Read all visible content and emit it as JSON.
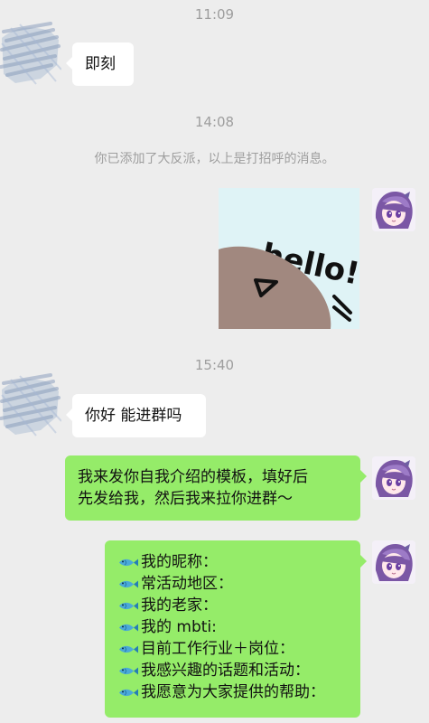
{
  "chat": {
    "timestamps": [
      "11:09",
      "14:08",
      "15:40"
    ],
    "system_notice": "你已添加了大反派，以上是打招呼的消息。",
    "messages": {
      "incoming_1": "即刻",
      "incoming_2": "你好 能进群吗",
      "outgoing_1_line_1": "我来发你自我介绍的模板，填好后",
      "outgoing_1_line_2": "先发给我，然后我来拉你进群～"
    },
    "sticker": {
      "text": "hello!"
    },
    "template_items": [
      "我的昵称：",
      "常活动地区：",
      "我的老家：",
      "我的 mbti:",
      "目前工作行业＋岗位：",
      "我感兴趣的话题和活动：",
      "我愿意为大家提供的帮助："
    ]
  }
}
